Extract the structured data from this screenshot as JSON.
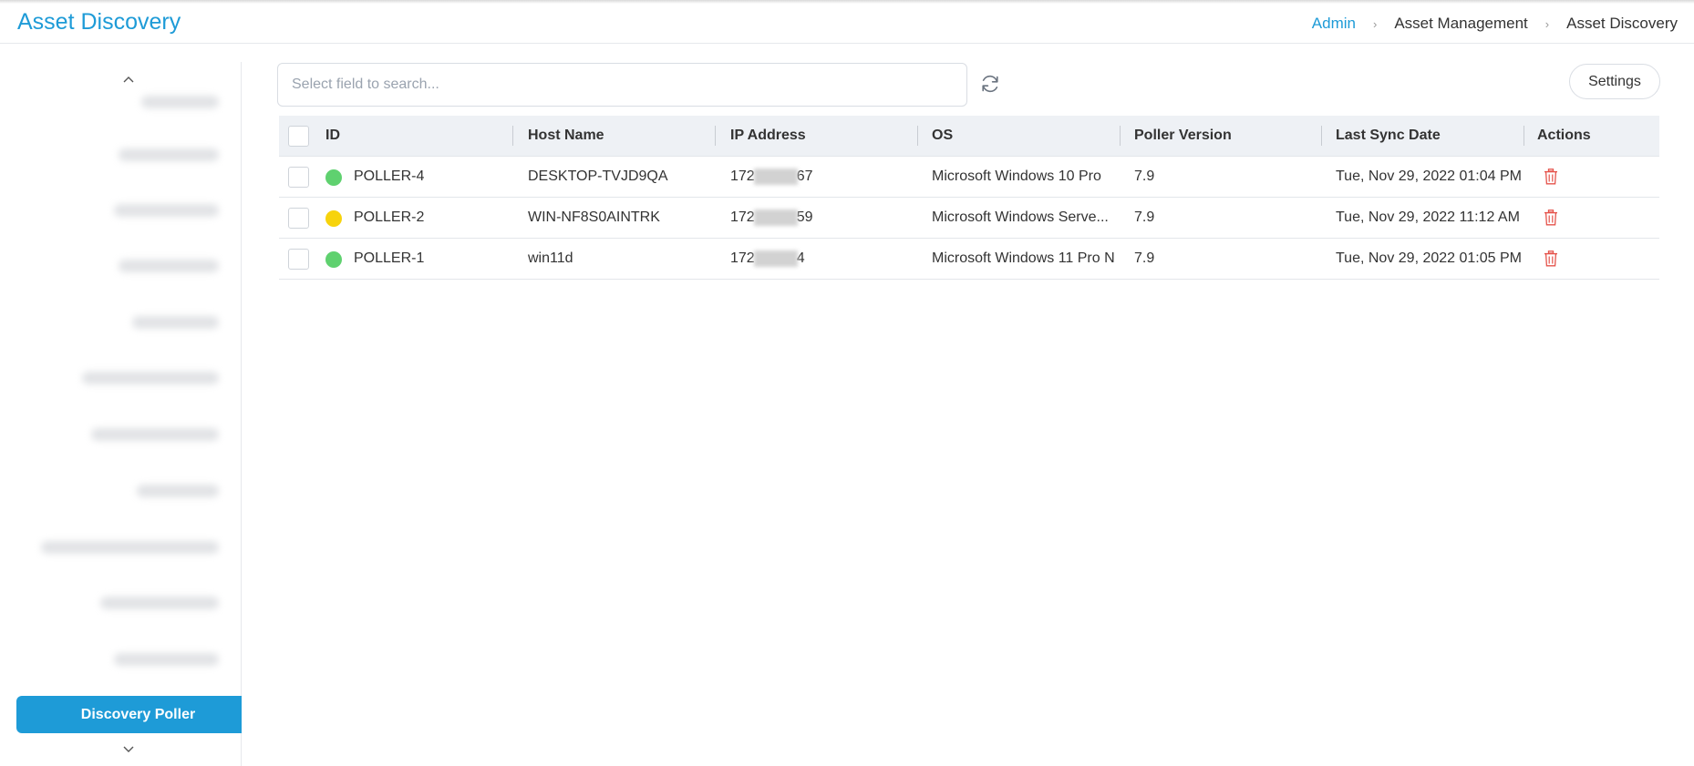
{
  "header": {
    "title": "Asset Discovery",
    "breadcrumb": [
      "Admin",
      "Asset Management",
      "Asset Discovery"
    ]
  },
  "sidebar": {
    "active_item": "Discovery Poller"
  },
  "toolbar": {
    "search_placeholder": "Select field to search...",
    "settings_label": "Settings"
  },
  "table": {
    "columns": [
      "ID",
      "Host Name",
      "IP Address",
      "OS",
      "Poller Version",
      "Last Sync Date",
      "Actions"
    ],
    "rows": [
      {
        "id": "POLLER-4",
        "status_color": "#5fd16f",
        "host": "DESKTOP-TVJD9QA",
        "ip_prefix": "172",
        "ip_suffix": "67",
        "os": "Microsoft Windows 10 Pro",
        "version": "7.9",
        "last_sync": "Tue, Nov 29, 2022 01:04 PM"
      },
      {
        "id": "POLLER-2",
        "status_color": "#f7d30c",
        "host": "WIN-NF8S0AINTRK",
        "ip_prefix": "172",
        "ip_suffix": "59",
        "os": "Microsoft Windows Serve...",
        "version": "7.9",
        "last_sync": "Tue, Nov 29, 2022 11:12 AM"
      },
      {
        "id": "POLLER-1",
        "status_color": "#5fd16f",
        "host": "win11d",
        "ip_prefix": "172",
        "ip_suffix": "4",
        "os": "Microsoft Windows 11 Pro N",
        "version": "7.9",
        "last_sync": "Tue, Nov 29, 2022 01:05 PM"
      }
    ]
  },
  "colors": {
    "accent": "#1e9bd7",
    "delete": "#e5534b"
  }
}
